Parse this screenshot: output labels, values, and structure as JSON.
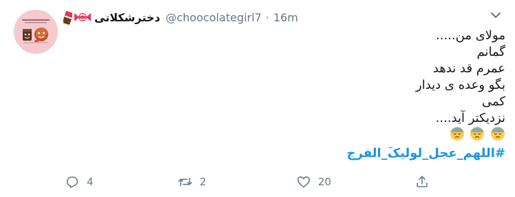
{
  "tweet": {
    "author": {
      "display_name": "دخترشکلاتی",
      "handle": "@choocolategirl7",
      "avatar_caption": "دختر شکلاتی"
    },
    "separator": "·",
    "time": "16m",
    "lines": [
      "مولای من.....",
      "گمانم",
      "عمرم قد ندهد",
      "بگو وعده ی دیدار",
      "کمی",
      "نزدیکتر آید...."
    ],
    "emoji": [
      "downcast-face-with-sweat",
      "downcast-face-with-sweat",
      "downcast-face-with-sweat"
    ],
    "hashtag": "#اللهم_عجل_لولیکَ_الفرج"
  },
  "actions": {
    "reply_count": "4",
    "retweet_count": "2",
    "like_count": "20"
  },
  "icons": [
    "chocolate-bar-icon",
    "candy-icon",
    "chevron-down-icon",
    "reply-icon",
    "retweet-icon",
    "like-icon",
    "share-icon"
  ],
  "colors": {
    "link": "#1b95e0",
    "secondary_text": "#657786",
    "avatar_background": "#f6c9cf"
  }
}
